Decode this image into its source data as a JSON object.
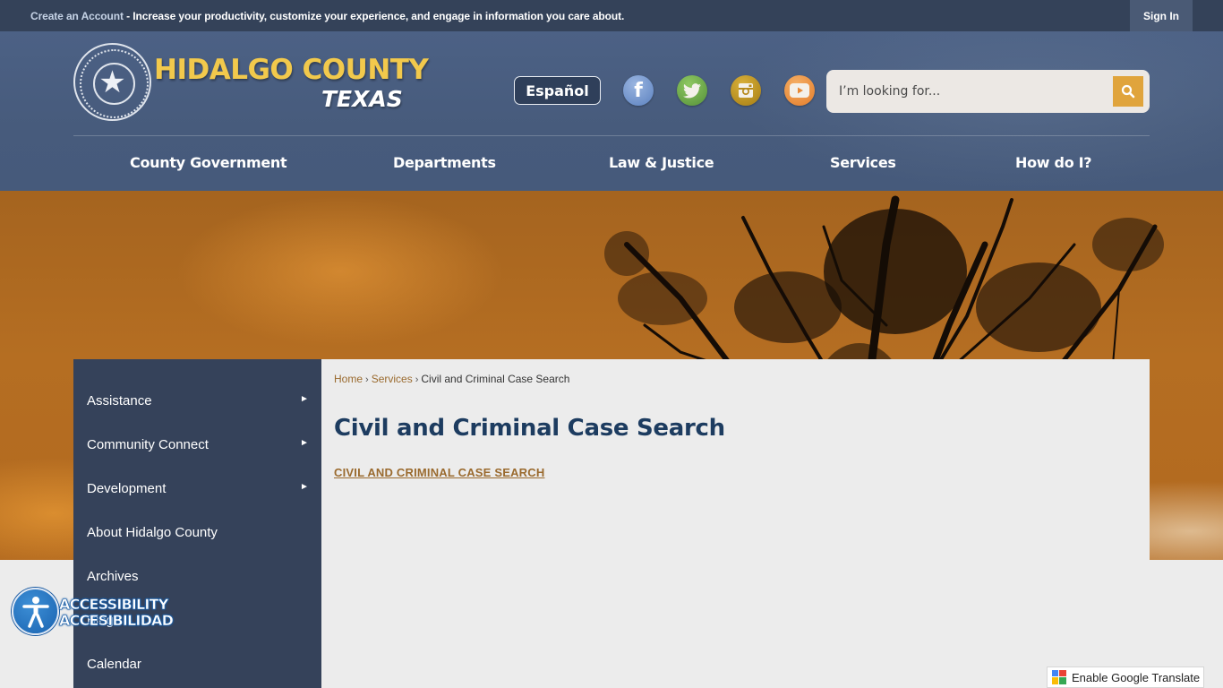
{
  "topbar": {
    "create_account_link": "Create an Account",
    "promo_text": " - Increase your productivity, customize your experience, and engage in information you care about.",
    "sign_in": "Sign In"
  },
  "header": {
    "logo_name": "HIDALGO COUNTY",
    "logo_state": "TEXAS",
    "seal_icon": "star-glyph",
    "espanol_button": "Español",
    "social": [
      {
        "name": "facebook",
        "icon": "facebook-icon",
        "color": "#6f92cc"
      },
      {
        "name": "twitter",
        "icon": "twitter-icon",
        "color": "#6aa846"
      },
      {
        "name": "instagram",
        "icon": "instagram-icon",
        "color": "#c0951f"
      },
      {
        "name": "youtube",
        "icon": "youtube-icon",
        "color": "#ec9140"
      }
    ],
    "search": {
      "placeholder": "I’m looking for...",
      "value": "",
      "button_icon": "search-icon",
      "button_color": "#e0a43c"
    }
  },
  "main_nav": [
    {
      "label": "County Government"
    },
    {
      "label": "Departments"
    },
    {
      "label": "Law & Justice"
    },
    {
      "label": "Services"
    },
    {
      "label": "How do I?"
    }
  ],
  "sidebar": {
    "items": [
      {
        "label": "Assistance",
        "has_submenu": true,
        "arrow": "►"
      },
      {
        "label": "Community Connect",
        "has_submenu": true,
        "arrow": "►"
      },
      {
        "label": "Development",
        "has_submenu": true,
        "arrow": "►"
      },
      {
        "label": "About Hidalgo County",
        "has_submenu": false
      },
      {
        "label": "Archives",
        "has_submenu": false
      },
      {
        "label": "Blog",
        "has_submenu": false
      },
      {
        "label": "Calendar",
        "has_submenu": false
      }
    ]
  },
  "breadcrumb": {
    "items": [
      "Home",
      "Services",
      "Civil and Criminal Case Search"
    ],
    "separator": "›"
  },
  "content": {
    "title": "Civil and Criminal Case Search",
    "link_label": "CIVIL AND CRIMINAL CASE SEARCH"
  },
  "accessibility": {
    "line1": "ACCESSIBILITY",
    "line2": "ACCESIBILIDAD"
  },
  "google_translate": {
    "label": "Enable Google Translate"
  },
  "colors": {
    "topbar_bg": "#344259",
    "header_bg": "#475b7c",
    "sidebar_bg": "#35425a",
    "accent_gold": "#f2c94c",
    "link_brown": "#9a6a2e",
    "title_blue": "#1d3c60"
  }
}
